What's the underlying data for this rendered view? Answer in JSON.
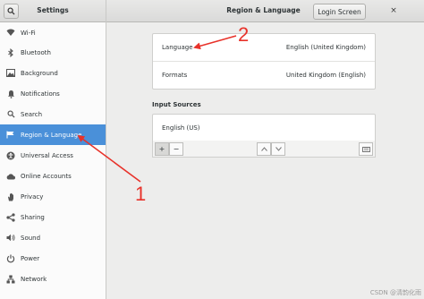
{
  "header": {
    "sidebar_title": "Settings",
    "panel_title": "Region & Language",
    "login_screen_label": "Login Screen",
    "close_glyph": "×"
  },
  "sidebar": {
    "items": [
      {
        "label": "Wi-Fi",
        "icon": "wifi-icon"
      },
      {
        "label": "Bluetooth",
        "icon": "bluetooth-icon"
      },
      {
        "label": "Background",
        "icon": "background-icon"
      },
      {
        "label": "Notifications",
        "icon": "notifications-icon"
      },
      {
        "label": "Search",
        "icon": "search-icon"
      },
      {
        "label": "Region & Language",
        "icon": "flag-icon",
        "active": true
      },
      {
        "label": "Universal Access",
        "icon": "accessibility-icon"
      },
      {
        "label": "Online Accounts",
        "icon": "cloud-icon"
      },
      {
        "label": "Privacy",
        "icon": "hand-icon"
      },
      {
        "label": "Sharing",
        "icon": "share-icon"
      },
      {
        "label": "Sound",
        "icon": "speaker-icon"
      },
      {
        "label": "Power",
        "icon": "power-icon"
      },
      {
        "label": "Network",
        "icon": "network-icon"
      }
    ]
  },
  "main": {
    "language_label": "Language",
    "language_value": "English (United Kingdom)",
    "formats_label": "Formats",
    "formats_value": "United Kingdom (English)",
    "input_sources_title": "Input Sources",
    "input_source_item": "English (US)",
    "add_glyph": "+",
    "remove_glyph": "−"
  },
  "annotations": {
    "label_1": "1",
    "label_2": "2",
    "arrow_color": "#e8322a"
  },
  "watermark": "CSDN @清韵化雨",
  "colors": {
    "accent": "#4a90d9"
  }
}
